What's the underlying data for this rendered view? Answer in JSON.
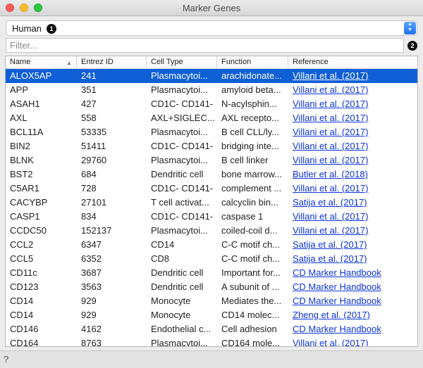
{
  "window": {
    "title": "Marker Genes"
  },
  "organism": {
    "value": "Human",
    "badge": "1"
  },
  "filter": {
    "placeholder": "Filter...",
    "badge": "2"
  },
  "table": {
    "columns": [
      "Name",
      "Entrez ID",
      "Cell Type",
      "Function",
      "Reference"
    ],
    "sort_icon": "sort-ascending-icon",
    "selected_row": 0,
    "rows": [
      [
        "ALOX5AP",
        "241",
        "Plasmacytoi...",
        "arachidonate...",
        "Villani et al. (2017)"
      ],
      [
        "APP",
        "351",
        "Plasmacytoi...",
        "amyloid beta...",
        "Villani et al. (2017)"
      ],
      [
        "ASAH1",
        "427",
        "CD1C- CD141-",
        "N-acylsphin...",
        "Villani et al. (2017)"
      ],
      [
        "AXL",
        "558",
        "AXL+SIGLEC...",
        "AXL recepto...",
        "Villani et al. (2017)"
      ],
      [
        "BCL11A",
        "53335",
        "Plasmacytoi...",
        "B cell CLL/ly...",
        "Villani et al. (2017)"
      ],
      [
        "BIN2",
        "51411",
        "CD1C- CD141-",
        "bridging inte...",
        "Villani et al. (2017)"
      ],
      [
        "BLNK",
        "29760",
        "Plasmacytoi...",
        "B cell linker",
        "Villani et al. (2017)"
      ],
      [
        "BST2",
        "684",
        "Dendritic cell",
        "bone marrow...",
        "Butler et al. (2018)"
      ],
      [
        "C5AR1",
        "728",
        "CD1C- CD141-",
        "complement ...",
        "Villani et al. (2017)"
      ],
      [
        "CACYBP",
        "27101",
        "T cell activat...",
        "calcyclin bin...",
        "Satija et al. (2017)"
      ],
      [
        "CASP1",
        "834",
        "CD1C- CD141-",
        "caspase 1",
        "Villani et al. (2017)"
      ],
      [
        "CCDC50",
        "152137",
        "Plasmacytoi...",
        "coiled-coil d...",
        "Villani et al. (2017)"
      ],
      [
        "CCL2",
        "6347",
        "CD14",
        "C-C motif ch...",
        "Satija et al. (2017)"
      ],
      [
        "CCL5",
        "6352",
        "CD8",
        "C-C motif ch...",
        "Satija et al. (2017)"
      ],
      [
        "CD11c",
        "3687",
        "Dendritic cell",
        "Important for...",
        "CD Marker Handbook"
      ],
      [
        "CD123",
        "3563",
        "Dendritic cell",
        "A subunit of ...",
        "CD Marker Handbook"
      ],
      [
        "CD14",
        "929",
        "Monocyte",
        "Mediates the...",
        "CD Marker Handbook"
      ],
      [
        "CD14",
        "929",
        "Monocyte",
        "CD14 molec...",
        "Zheng et al. (2017)"
      ],
      [
        "CD146",
        "4162",
        "Endothelial c...",
        "Cell adhesion",
        "CD Marker Handbook"
      ],
      [
        "CD164",
        "8763",
        "Plasmacytoi...",
        "CD164 mole...",
        "Villani et al. (2017)"
      ]
    ]
  },
  "status": {
    "help": "?"
  }
}
